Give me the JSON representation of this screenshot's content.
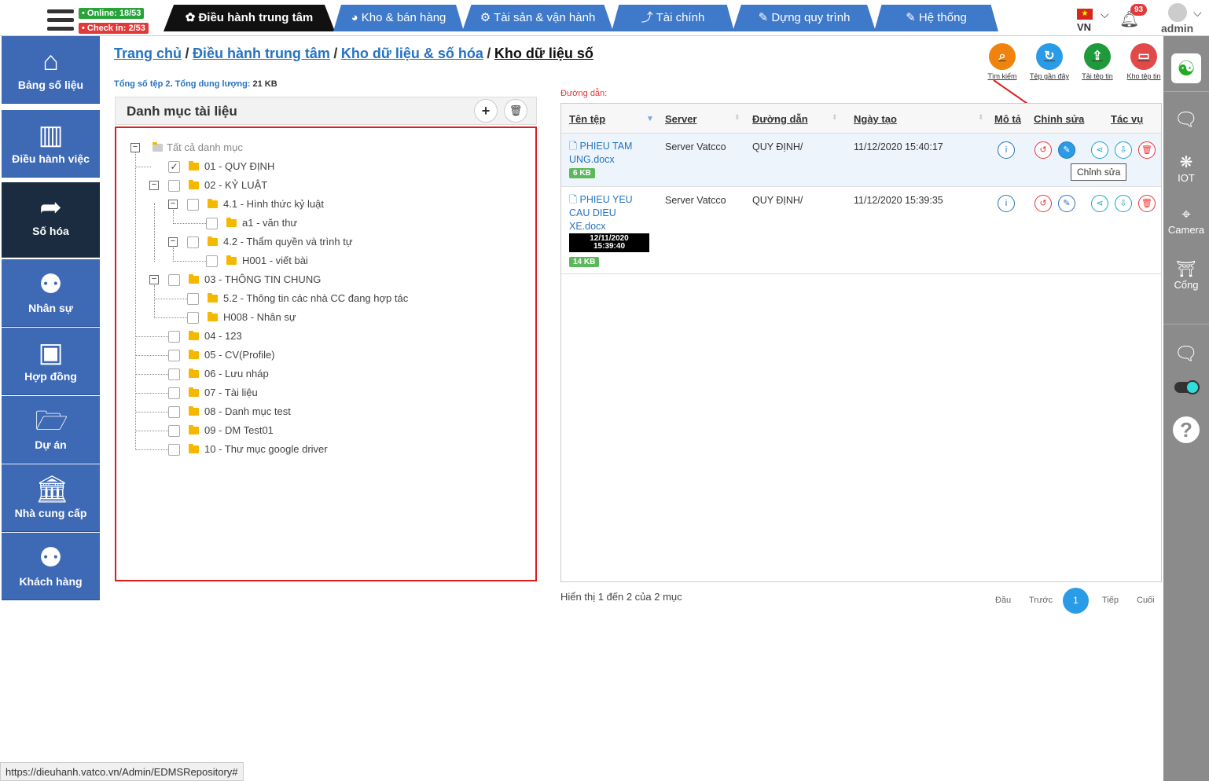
{
  "topbar": {
    "online": "• Online: 18/53",
    "checkin": "• Check in: 2/53",
    "tabs": [
      {
        "label": "✿ Điều hành trung tâm"
      },
      {
        "label": "◕ Kho & bán hàng"
      },
      {
        "label": "⚙ Tài sản & vận hành"
      },
      {
        "label": "⤴ Tài chính"
      },
      {
        "label": "✎ Dựng quy trình"
      },
      {
        "label": "✎ Hệ thống"
      }
    ],
    "lang": "VN",
    "notif_count": "93",
    "user": "admin"
  },
  "sidebar": {
    "items": [
      {
        "label": "Bảng số liệu",
        "icon": "home-icon"
      },
      {
        "label": "Điều hành việc",
        "icon": "board-icon"
      },
      {
        "label": "Số hóa",
        "icon": "share-icon"
      },
      {
        "label": "Nhân sự",
        "icon": "users-icon"
      },
      {
        "label": "Hợp đồng",
        "icon": "briefcase-icon"
      },
      {
        "label": "Dự án",
        "icon": "folder-open-icon"
      },
      {
        "label": "Nhà cung cấp",
        "icon": "bank-icon"
      },
      {
        "label": "Khách hàng",
        "icon": "users-icon"
      }
    ]
  },
  "right_panel": {
    "iot": "IOT",
    "camera": "Camera",
    "gate": "Cổng"
  },
  "breadcrumb": {
    "home": "Trang chủ",
    "center": "Điều hành trung tâm",
    "repo": "Kho dữ liệu & số hóa",
    "current": "Kho dữ liệu số",
    "sep": "/"
  },
  "summary": {
    "prefix": "Tổng số tệp",
    "count": "2",
    "size_label": "Tổng dung lượng:",
    "size": "21 KB"
  },
  "actions": {
    "search": "Tìm kiếm",
    "recent": "Tệp gần đây",
    "upload": "Tải tệp tin",
    "store": "Kho tệp tin"
  },
  "tree": {
    "title": "Danh mục tài liệu",
    "root": "Tất cả danh mục",
    "nodes": [
      {
        "label": "01 - QUY ĐỊNH",
        "checked": true
      },
      {
        "label": "02 - KỶ LUẬT"
      },
      {
        "label": "4.1 - Hình thức kỷ luật"
      },
      {
        "label": "a1 - văn thư"
      },
      {
        "label": "4.2 - Thẩm quyền và trình tự"
      },
      {
        "label": "H001 - viết bài"
      },
      {
        "label": "03 - THÔNG TIN CHUNG"
      },
      {
        "label": "5.2 - Thông tin các nhà CC đang hợp tác"
      },
      {
        "label": "H008 - Nhân sự"
      },
      {
        "label": "04 - 123"
      },
      {
        "label": "05 - CV(Profile)"
      },
      {
        "label": "06 - Lưu nháp"
      },
      {
        "label": "07 - Tài liệu"
      },
      {
        "label": "08 - Danh mục test"
      },
      {
        "label": "09 - DM Test01"
      },
      {
        "label": "10 - Thư mục google driver"
      }
    ]
  },
  "path_label": "Đường dẫn:",
  "table": {
    "headers": {
      "name": "Tên tệp",
      "server": "Server",
      "path": "Đường dẫn",
      "created": "Ngày tạo",
      "desc": "Mô tả",
      "edit": "Chỉnh sửa",
      "tasks": "Tác vụ"
    },
    "rows": [
      {
        "name1": "PHIEU TAM",
        "name2": "UNG.docx",
        "name3": "",
        "size": "6 KB",
        "server": "Server Vatcco",
        "path": "QUY ĐỊNH/",
        "created": "11/12/2020 15:40:17"
      },
      {
        "name1": "PHIEU YEU",
        "name2": "CAU DIEU",
        "name3": "XE.docx",
        "badge_date": "12/11/2020",
        "badge_time": "15:39:40",
        "size": "14 KB",
        "server": "Server Vatcco",
        "path": "QUY ĐỊNH/",
        "created": "11/12/2020 15:39:35"
      }
    ],
    "tooltip": "Chỉnh sửa"
  },
  "pagination": {
    "info": "Hiển thị 1 đến 2 của 2 mục",
    "first": "Đầu",
    "prev": "Trước",
    "page": "1",
    "next": "Tiếp",
    "last": "Cuối"
  },
  "statusbar": {
    "url": "https://dieuhanh.vatco.vn/Admin/EDMSRepository#"
  },
  "colors": {
    "sidebar": "#3d69b5",
    "sidebar_active": "#1b2b40",
    "link": "#2673c2",
    "highlight_border": "#e01a1a"
  }
}
